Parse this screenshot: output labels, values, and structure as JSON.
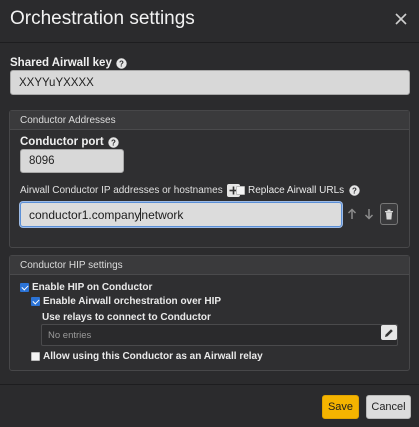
{
  "dialog": {
    "title": "Orchestration settings"
  },
  "shared_key": {
    "label": "Shared Airwall key",
    "value": "XXYYuYXXXX"
  },
  "conductor_addresses": {
    "header": "Conductor Addresses",
    "port_label": "Conductor port",
    "port_value": "8096",
    "ip_label": "Airwall Conductor IP addresses or hostnames",
    "replace_label": "Replace Airwall URLs",
    "replace_checked": false,
    "address_before_caret": "conductor1.company",
    "address_after_caret": "network"
  },
  "conductor_hip": {
    "header": "Conductor HIP settings",
    "enable_hip_label": "Enable HIP on Conductor",
    "enable_hip_checked": true,
    "enable_orchestration_label": "Enable Airwall orchestration over HIP",
    "enable_orchestration_checked": true,
    "relays_label": "Use relays to connect to Conductor",
    "relays_empty": "No entries",
    "allow_relay_label": "Allow using this Conductor as an Airwall relay",
    "allow_relay_checked": false
  },
  "footer": {
    "save_label": "Save",
    "cancel_label": "Cancel"
  },
  "icons": {
    "help": "help-circle-icon",
    "close": "close-icon",
    "add": "plus-icon",
    "up": "arrow-up-icon",
    "down": "arrow-down-icon",
    "delete": "trash-icon",
    "edit": "pencil-icon"
  },
  "colors": {
    "background": "#2b2b2d",
    "accent_save": "#f5b400",
    "checkbox_checked": "#2b73d6",
    "focus_border": "#5b8fd6"
  }
}
